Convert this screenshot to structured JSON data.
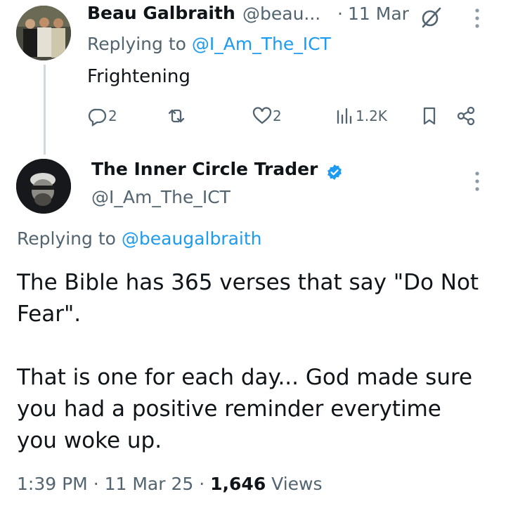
{
  "reply_tweet": {
    "author_name": "Beau Galbraith",
    "handle": "@beau...",
    "separator": "·",
    "date": "11 Mar",
    "replying_prefix": "Replying to ",
    "replying_to": "@I_Am_The_ICT",
    "text": "Frightening",
    "actions": {
      "replies": "2",
      "likes": "2",
      "views": "1.2K"
    },
    "icons": [
      "grok-icon",
      "more-icon",
      "reply-icon",
      "retweet-icon",
      "like-icon",
      "views-icon",
      "bookmark-icon",
      "share-icon"
    ]
  },
  "main_tweet": {
    "author_name": "The Inner Circle Trader",
    "verified": true,
    "handle": "@I_Am_The_ICT",
    "replying_prefix": "Replying to ",
    "replying_to": "@beaugalbraith",
    "paragraph1": "The Bible has 365 verses that say \"Do Not Fear\".",
    "paragraph2": "That is one for each day... God made sure you had a positive reminder everytime you woke up.",
    "time": "1:39 PM",
    "dot": "·",
    "date": "11 Mar 25",
    "views_count": "1,646",
    "views_label": "Views"
  },
  "colors": {
    "link": "#1d9bf0",
    "muted": "#536471",
    "text": "#0f1419",
    "thread_line": "#cfd9de"
  }
}
